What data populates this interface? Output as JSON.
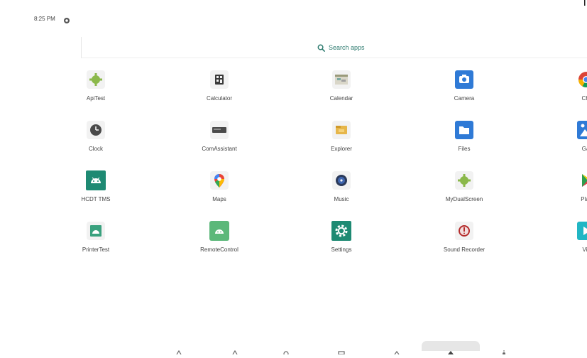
{
  "status": {
    "time": "8:25 PM"
  },
  "search": {
    "label": "Search apps"
  },
  "apps": [
    {
      "label": "ApiTest"
    },
    {
      "label": "Calculator"
    },
    {
      "label": "Calendar"
    },
    {
      "label": "Camera"
    },
    {
      "label": "Chr"
    },
    {
      "label": "Clock"
    },
    {
      "label": "ComAssistant"
    },
    {
      "label": "Explorer"
    },
    {
      "label": "Files"
    },
    {
      "label": "Gal"
    },
    {
      "label": "HCDT TMS"
    },
    {
      "label": "Maps"
    },
    {
      "label": "Music"
    },
    {
      "label": "MyDualScreen"
    },
    {
      "label": "Play"
    },
    {
      "label": "PrinterTest"
    },
    {
      "label": "RemoteControl"
    },
    {
      "label": "Settings"
    },
    {
      "label": "Sound Recorder"
    },
    {
      "label": "Vic"
    }
  ],
  "colors": {
    "accent": "#2d7b6f",
    "blue": "#2f7ad6",
    "green": "#3aa17e",
    "teal": "#1e8a73"
  }
}
